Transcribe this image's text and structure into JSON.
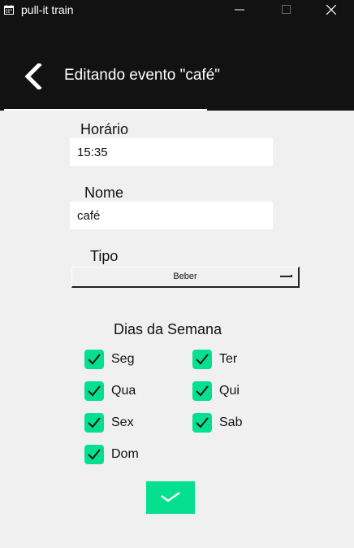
{
  "window": {
    "title": "pull-it train",
    "app_icon": "calendar-icon",
    "controls": [
      "minimize-icon",
      "maximize-icon",
      "close-icon"
    ]
  },
  "header": {
    "back_icon": "chevron-left-icon",
    "title": "Editando evento \"café\""
  },
  "form": {
    "horario": {
      "label": "Horário",
      "value": "15:35"
    },
    "nome": {
      "label": "Nome",
      "value": "café"
    },
    "tipo": {
      "label": "Tipo",
      "selected": "Beber"
    }
  },
  "days": {
    "title": "Dias da Semana",
    "items": [
      {
        "label": "Seg",
        "checked": true
      },
      {
        "label": "Ter",
        "checked": true
      },
      {
        "label": "Qua",
        "checked": true
      },
      {
        "label": "Qui",
        "checked": true
      },
      {
        "label": "Sex",
        "checked": true
      },
      {
        "label": "Sab",
        "checked": true
      },
      {
        "label": "Dom",
        "checked": true
      }
    ]
  },
  "confirm": {
    "icon": "checkmark-icon"
  },
  "colors": {
    "accent": "#04e08f",
    "header_bg": "#121212",
    "page_bg": "#f0f0f0"
  }
}
